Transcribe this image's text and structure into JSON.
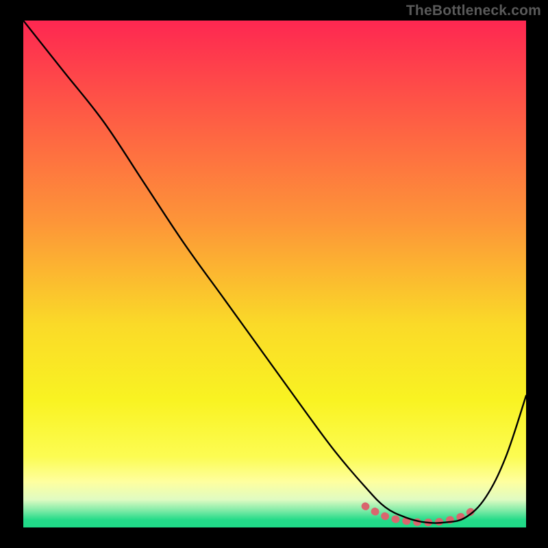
{
  "watermark": "TheBottleneck.com",
  "chart_data": {
    "type": "line",
    "title": "",
    "xlabel": "",
    "ylabel": "",
    "xlim": [
      0,
      100
    ],
    "ylim": [
      0,
      100
    ],
    "series": [
      {
        "name": "bottleneck-curve",
        "x": [
          0,
          8,
          16,
          24,
          32,
          40,
          48,
          56,
          62,
          68,
          72,
          76,
          80,
          84,
          88,
          92,
          96,
          100
        ],
        "y": [
          100,
          90,
          80,
          68,
          56,
          45,
          34,
          23,
          15,
          8,
          4,
          2,
          1,
          1,
          2,
          6,
          14,
          26
        ],
        "color": "#000000"
      },
      {
        "name": "optimal-zone-marker",
        "x": [
          68,
          72,
          76,
          80,
          84,
          88,
          90
        ],
        "y": [
          4.2,
          2.2,
          1.3,
          1.0,
          1.3,
          2.5,
          4.0
        ],
        "color": "#d9666e"
      }
    ],
    "background_gradient": {
      "stops": [
        {
          "pos": 0.0,
          "color": "#fe2751"
        },
        {
          "pos": 0.2,
          "color": "#fe5f44"
        },
        {
          "pos": 0.4,
          "color": "#fd9638"
        },
        {
          "pos": 0.6,
          "color": "#fada28"
        },
        {
          "pos": 0.75,
          "color": "#f9f322"
        },
        {
          "pos": 0.86,
          "color": "#fcfc52"
        },
        {
          "pos": 0.91,
          "color": "#feff9f"
        },
        {
          "pos": 0.945,
          "color": "#e0fbc2"
        },
        {
          "pos": 0.965,
          "color": "#86eca9"
        },
        {
          "pos": 0.985,
          "color": "#24db89"
        },
        {
          "pos": 1.0,
          "color": "#1fd988"
        }
      ]
    }
  }
}
